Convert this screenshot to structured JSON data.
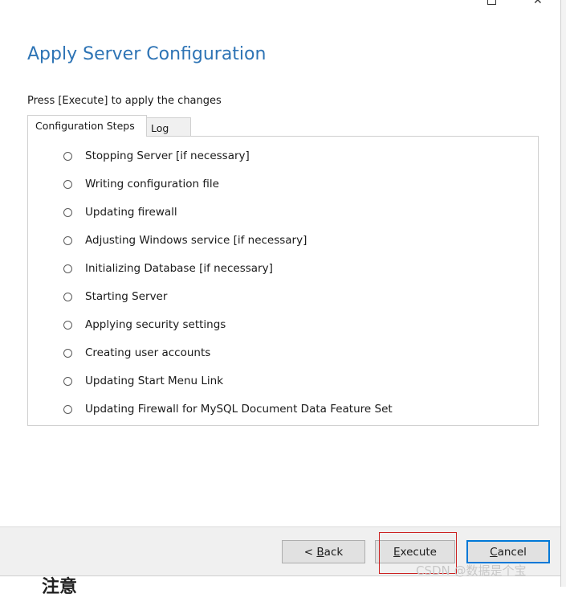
{
  "header": {
    "title": "Apply Server Configuration"
  },
  "instruction": "Press [Execute] to apply the changes",
  "tabs": [
    {
      "label": "Configuration Steps",
      "active": true
    },
    {
      "label": "Log",
      "active": false
    }
  ],
  "steps": [
    {
      "label": "Stopping Server [if necessary]",
      "done": false
    },
    {
      "label": "Writing configuration file",
      "done": false
    },
    {
      "label": "Updating firewall",
      "done": false
    },
    {
      "label": "Adjusting Windows service [if necessary]",
      "done": false
    },
    {
      "label": "Initializing Database [if necessary]",
      "done": false
    },
    {
      "label": "Starting Server",
      "done": false
    },
    {
      "label": "Applying security settings",
      "done": false
    },
    {
      "label": "Creating user accounts",
      "done": false
    },
    {
      "label": "Updating Start Menu Link",
      "done": false
    },
    {
      "label": "Updating Firewall for MySQL Document Data Feature Set",
      "done": false
    }
  ],
  "buttons": {
    "back": {
      "prefix": "< ",
      "accel": "B",
      "rest": "ack"
    },
    "execute": {
      "accel": "E",
      "rest": "xecute"
    },
    "cancel": {
      "accel": "C",
      "rest": "ancel"
    }
  },
  "watermark": "CSDN @数据是个宝",
  "background_text": "注意",
  "colors": {
    "title": "#2e74b5",
    "highlight": "#cc2222",
    "focus": "#0078d7"
  },
  "icons": {
    "window_restore": "restore-icon",
    "window_close": "close-icon",
    "step_status": "radio-icon"
  }
}
